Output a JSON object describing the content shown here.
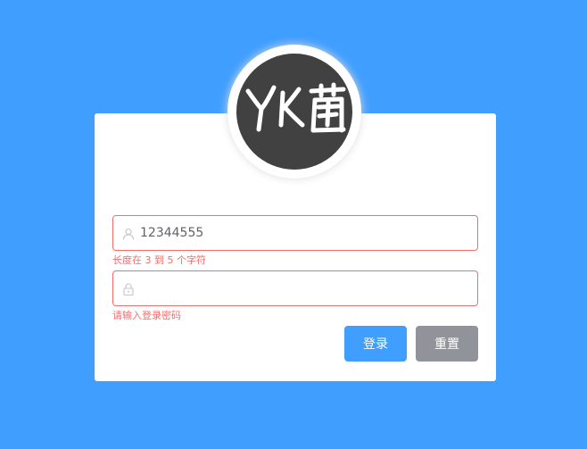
{
  "avatar": {
    "logo_text": "YK菌"
  },
  "form": {
    "username": {
      "value": "12344555",
      "error": "长度在 3 到 5 个字符",
      "icon": "user-icon"
    },
    "password": {
      "value": "",
      "error": "请输入登录密码",
      "icon": "lock-icon"
    }
  },
  "buttons": {
    "login_label": "登录",
    "reset_label": "重置"
  },
  "colors": {
    "background": "#409eff",
    "primary": "#409eff",
    "info": "#909399",
    "danger": "#f56c6c",
    "avatar_bg": "#414141"
  }
}
